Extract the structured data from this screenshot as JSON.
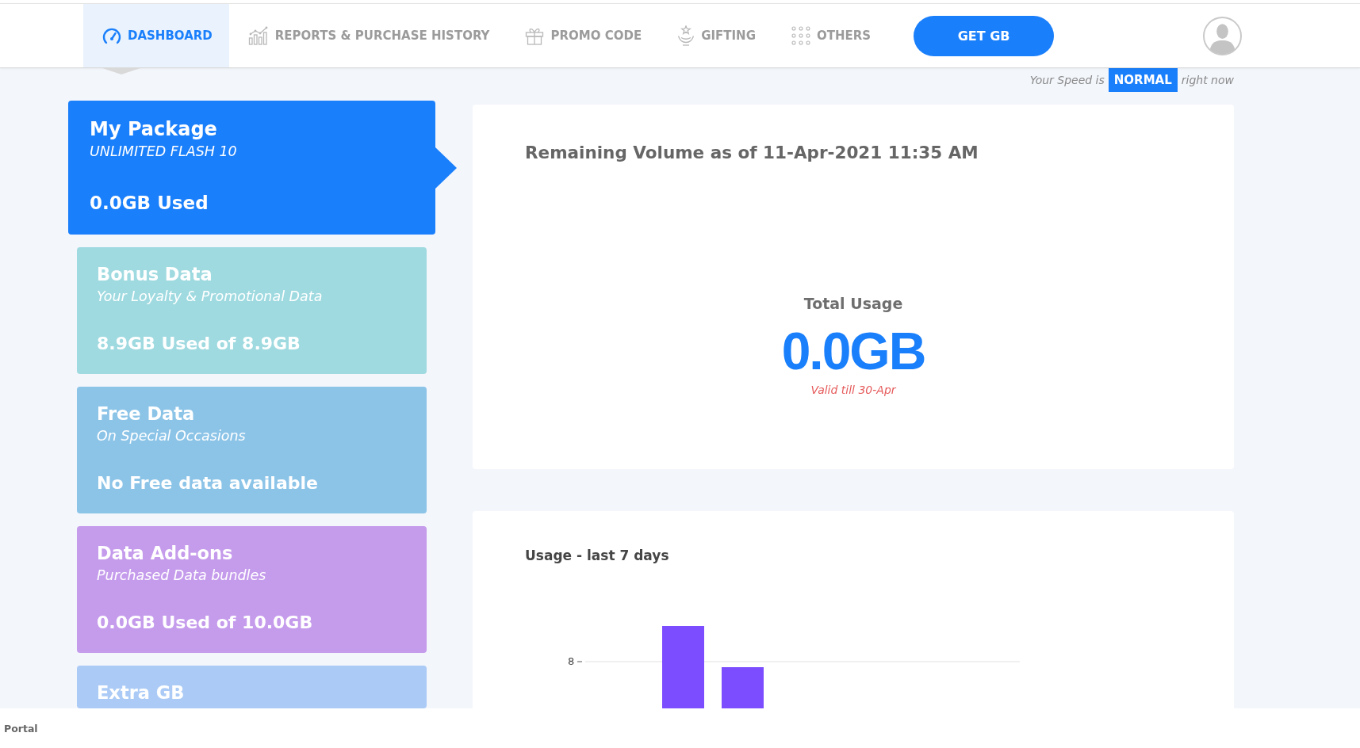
{
  "nav": {
    "tabs": [
      {
        "label": "DASHBOARD",
        "selected": true
      },
      {
        "label": "REPORTS & PURCHASE HISTORY",
        "selected": false
      },
      {
        "label": "PROMO CODE",
        "selected": false
      },
      {
        "label": "GIFTING",
        "selected": false
      },
      {
        "label": "OTHERS",
        "selected": false
      }
    ],
    "get_gb_button": "GET GB"
  },
  "speed_notice": {
    "prefix": "Your Speed is",
    "status": "NORMAL",
    "suffix": "right now"
  },
  "cards": [
    {
      "title": "My Package",
      "subtitle": "UNLIMITED FLASH 10",
      "usage": "0.0GB Used",
      "color": "#1a7ffb",
      "selected": true
    },
    {
      "title": "Bonus Data",
      "subtitle": "Your Loyalty & Promotional Data",
      "usage": "8.9GB Used of 8.9GB",
      "color": "#9fdae0",
      "selected": false
    },
    {
      "title": "Free Data",
      "subtitle": "On Special Occasions",
      "usage": "No Free data available",
      "color": "#8cc4e8",
      "selected": false
    },
    {
      "title": "Data Add-ons",
      "subtitle": "Purchased Data bundles",
      "usage": "0.0GB Used of 10.0GB",
      "color": "#c59bec",
      "selected": false
    },
    {
      "title": "Extra GB",
      "color": "#abcbf6",
      "selected": false
    }
  ],
  "remaining_panel": {
    "title": "Remaining Volume as of 11-Apr-2021 11:35 AM",
    "total_label": "Total Usage",
    "total_value": "0.0GB",
    "validity": "Valid till 30-Apr"
  },
  "usage_panel": {
    "title": "Usage - last 7 days",
    "axis_label": "8"
  },
  "status_bar": {
    "text": "Portal"
  }
}
